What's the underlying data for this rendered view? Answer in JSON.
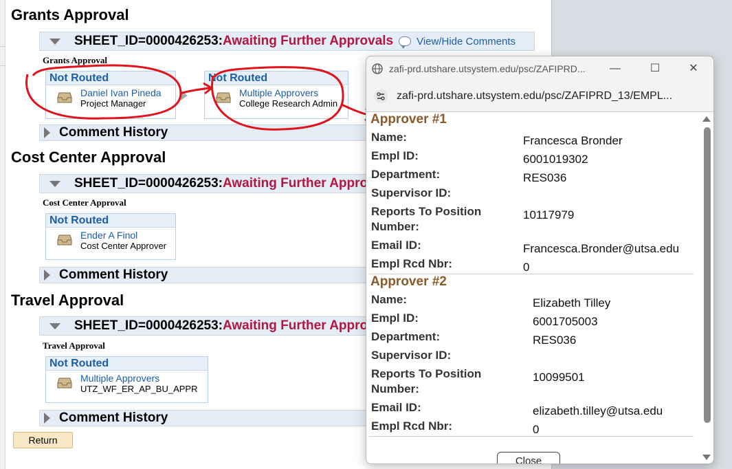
{
  "sections": [
    {
      "title": "Grants Approval",
      "sheet_id": "SHEET_ID=0000426253:",
      "status": "Awaiting Further Approvals",
      "comments_link": "View/Hide Comments",
      "group_label": "Grants Approval",
      "steps": [
        {
          "status": "Not Routed",
          "name": "Daniel Ivan Pineda",
          "role": "Project Manager"
        },
        {
          "status": "Not Routed",
          "name": "Multiple Approvers",
          "role": "College Research Admin"
        }
      ],
      "comment_history": "Comment History"
    },
    {
      "title": "Cost Center Approval",
      "sheet_id": "SHEET_ID=0000426253:",
      "status": "Awaiting Further Approvals",
      "group_label": "Cost Center Approval",
      "steps": [
        {
          "status": "Not Routed",
          "name": "Ender A Finol",
          "role": "Cost Center Approver"
        }
      ],
      "comment_history": "Comment History"
    },
    {
      "title": "Travel Approval",
      "sheet_id": "SHEET_ID=0000426253:",
      "status": "Awaiting Further Approvals",
      "group_label": "Travel Approval",
      "steps": [
        {
          "status": "Not Routed",
          "name": "Multiple Approvers",
          "role": "UTZ_WF_ER_AP_BU_APPR"
        }
      ],
      "comment_history": "Comment History"
    }
  ],
  "return_label": "Return",
  "popup": {
    "title": "zafi-prd.utshare.utsystem.edu/psc/ZAFIPRD...",
    "url": "zafi-prd.utshare.utsystem.edu/psc/ZAFIPRD_13/EMPL...",
    "labels": {
      "name": "Name:",
      "empl_id": "Empl ID:",
      "department": "Department:",
      "supervisor_id": "Supervisor ID:",
      "reports_to_1": "Reports To Position",
      "reports_to_2": "Number:",
      "email_id": "Email ID:",
      "empl_rcd": "Empl Rcd Nbr:"
    },
    "approvers": [
      {
        "heading": "Approver #1",
        "name": "Francesca Bronder",
        "empl_id": "6001019302",
        "department": "RES036",
        "supervisor_id": "",
        "reports_to": "10117979",
        "email": "Francesca.Bronder@utsa.edu",
        "empl_rcd": "0"
      },
      {
        "heading": "Approver #2",
        "name": "Elizabeth Tilley",
        "empl_id": "6001705003",
        "department": "RES036",
        "supervisor_id": "",
        "reports_to": "10099501",
        "email": "elizabeth.tilley@utsa.edu",
        "empl_rcd": "0"
      }
    ],
    "close_label": "Close"
  },
  "colors": {
    "status_red": "#b3163f",
    "link_blue": "#1b5ea8",
    "annotation_red": "#e0121c",
    "approver_heading": "#8b5a2b"
  }
}
